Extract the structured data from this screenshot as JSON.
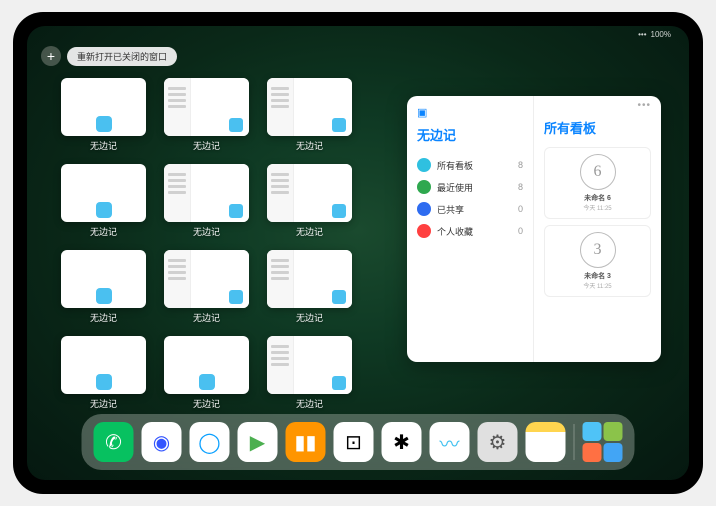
{
  "status": {
    "signal": "•••",
    "battery": "100%"
  },
  "topbar": {
    "add_symbol": "+",
    "reopen_label": "重新打开已关闭的窗口"
  },
  "app_switcher": {
    "app_label": "无边记",
    "rows": [
      [
        "blank",
        "sidebar",
        "sidebar"
      ],
      [
        "blank",
        "sidebar",
        "sidebar"
      ],
      [
        "blank",
        "sidebar",
        "sidebar"
      ],
      [
        "blank",
        "blank",
        "sidebar"
      ]
    ]
  },
  "panel": {
    "ellipsis": "•••",
    "left": {
      "title": "无边记",
      "items": [
        {
          "icon_color": "#2fc0e0",
          "label": "所有看板",
          "count": "8"
        },
        {
          "icon_color": "#2fa84f",
          "label": "最近使用",
          "count": "8"
        },
        {
          "icon_color": "#2e6cf0",
          "label": "已共享",
          "count": "0"
        },
        {
          "icon_color": "#ff4040",
          "label": "个人收藏",
          "count": "0"
        }
      ]
    },
    "right": {
      "title": "所有看板",
      "boards": [
        {
          "sketch": "6",
          "name": "未命名 6",
          "time": "今天 11:25"
        },
        {
          "sketch": "3",
          "name": "未命名 3",
          "time": "今天 11:25"
        }
      ]
    }
  },
  "dock": {
    "icons": [
      {
        "name": "wechat-icon",
        "bg": "#07c160",
        "glyph": "✆"
      },
      {
        "name": "browser-icon",
        "bg": "#fff",
        "glyph": "◉",
        "color": "#3355ff"
      },
      {
        "name": "qq-browser-icon",
        "bg": "#fff",
        "glyph": "◯",
        "color": "#0aa0ff"
      },
      {
        "name": "play-icon",
        "bg": "#fff",
        "glyph": "▶",
        "color": "#4caf50"
      },
      {
        "name": "books-icon",
        "bg": "#ff9500",
        "glyph": "▮▮",
        "color": "#fff"
      },
      {
        "name": "dice-icon",
        "bg": "#fff",
        "glyph": "⊡",
        "color": "#000"
      },
      {
        "name": "network-icon",
        "bg": "#fff",
        "glyph": "✱",
        "color": "#000"
      },
      {
        "name": "freeform-icon",
        "bg": "#fff",
        "glyph": "〰",
        "color": "#40c0f0"
      },
      {
        "name": "settings-icon",
        "bg": "#e0e0e0",
        "glyph": "⚙",
        "color": "#555"
      },
      {
        "name": "notes-icon",
        "bg": "linear-gradient(#ffd54f 25%,#fff 25%)",
        "glyph": "",
        "color": "#000"
      }
    ],
    "recent_colors": [
      "#4fc3f7",
      "#8bc34a",
      "#ff7043",
      "#42a5f5"
    ]
  }
}
